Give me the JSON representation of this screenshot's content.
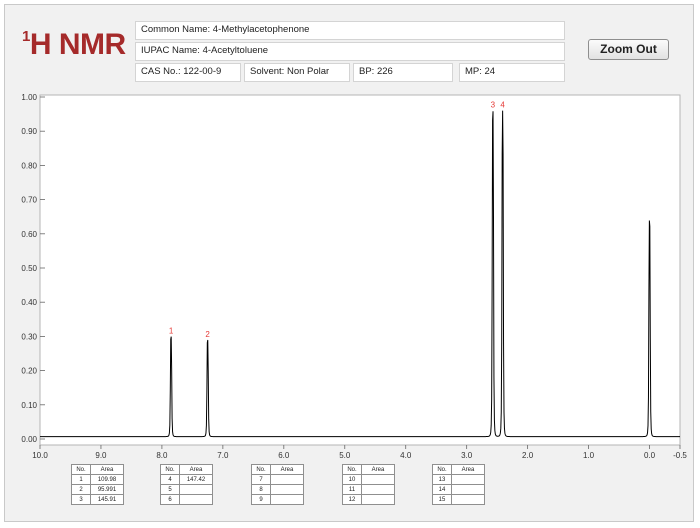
{
  "header": {
    "title_sup": "1",
    "title_main": "H NMR",
    "common_name": "Common Name:  4-Methylacetophenone",
    "iupac_name": "IUPAC Name:  4-Acetyltoluene",
    "cas": "CAS No.: 122-00-9",
    "solvent": "Solvent: Non Polar",
    "bp": "BP: 226",
    "mp": "MP: 24"
  },
  "toolbar": {
    "zoom_out_label": "Zoom Out"
  },
  "chart_data": {
    "type": "line",
    "title": "",
    "xlabel": "",
    "ylabel": "",
    "xlim": [
      10.0,
      -0.5
    ],
    "x_reversed": true,
    "ylim": [
      0.0,
      1.0
    ],
    "x_ticks": [
      "10.0",
      "9.0",
      "8.0",
      "7.0",
      "6.0",
      "5.0",
      "4.0",
      "3.0",
      "2.0",
      "1.0",
      "0.0",
      "-0.5"
    ],
    "y_ticks": [
      "0.00",
      "0.10",
      "0.20",
      "0.30",
      "0.40",
      "0.50",
      "0.60",
      "0.70",
      "0.80",
      "0.90",
      "1.00"
    ],
    "peaks": [
      {
        "label": "1",
        "ppm": 7.85,
        "height": 0.3
      },
      {
        "label": "2",
        "ppm": 7.25,
        "height": 0.29
      },
      {
        "label": "3",
        "ppm": 2.57,
        "height": 0.96
      },
      {
        "label": "4",
        "ppm": 2.41,
        "height": 0.96
      },
      {
        "label": "",
        "ppm": 0.0,
        "height": 0.64
      }
    ],
    "peak_label_color": "#e53935",
    "line_color": "#000000"
  },
  "peak_tables": [
    {
      "headers": [
        "No.",
        "Area"
      ],
      "rows": [
        [
          "1",
          "109.98"
        ],
        [
          "2",
          "95.991"
        ],
        [
          "3",
          "145.91"
        ]
      ]
    },
    {
      "headers": [
        "No.",
        "Area"
      ],
      "rows": [
        [
          "4",
          "147.42"
        ],
        [
          "5",
          ""
        ],
        [
          "6",
          ""
        ]
      ]
    },
    {
      "headers": [
        "No.",
        "Area"
      ],
      "rows": [
        [
          "7",
          ""
        ],
        [
          "8",
          ""
        ],
        [
          "9",
          ""
        ]
      ]
    },
    {
      "headers": [
        "No.",
        "Area"
      ],
      "rows": [
        [
          "10",
          ""
        ],
        [
          "11",
          ""
        ],
        [
          "12",
          ""
        ]
      ]
    },
    {
      "headers": [
        "No.",
        "Area"
      ],
      "rows": [
        [
          "13",
          ""
        ],
        [
          "14",
          ""
        ],
        [
          "15",
          ""
        ]
      ]
    }
  ]
}
